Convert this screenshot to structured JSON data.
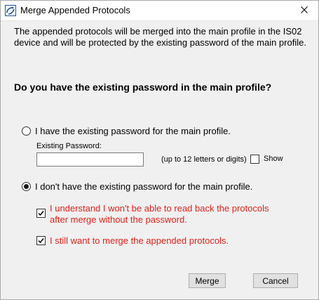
{
  "window": {
    "title": "Merge Appended Protocols",
    "app_icon": "protocol-app-icon",
    "close_icon": "close-icon"
  },
  "intro_text": "The appended protocols will be merged into the main profile in the IS02 device and will be protected by the existing password of the main profile.",
  "question": "Do you have the existing password in the main profile?",
  "option_have": {
    "label": "I have the existing password for the main profile.",
    "selected": false
  },
  "password": {
    "label": "Existing Password:",
    "value": "",
    "hint": "(up to 12 letters or digits)",
    "show_label": "Show",
    "show_checked": false
  },
  "option_dont_have": {
    "label": "I don't have the existing password for the main profile.",
    "selected": true
  },
  "confirm_readback": {
    "label": "I understand I won't be able to read back the protocols after merge without the password.",
    "checked": true
  },
  "confirm_merge": {
    "label": "I still want to merge the appended protocols.",
    "checked": true
  },
  "buttons": {
    "merge": "Merge",
    "cancel": "Cancel"
  },
  "colors": {
    "warning_text": "#e0201a",
    "dialog_bg": "#f0f0f0",
    "button_bg": "#e1e1e1"
  }
}
